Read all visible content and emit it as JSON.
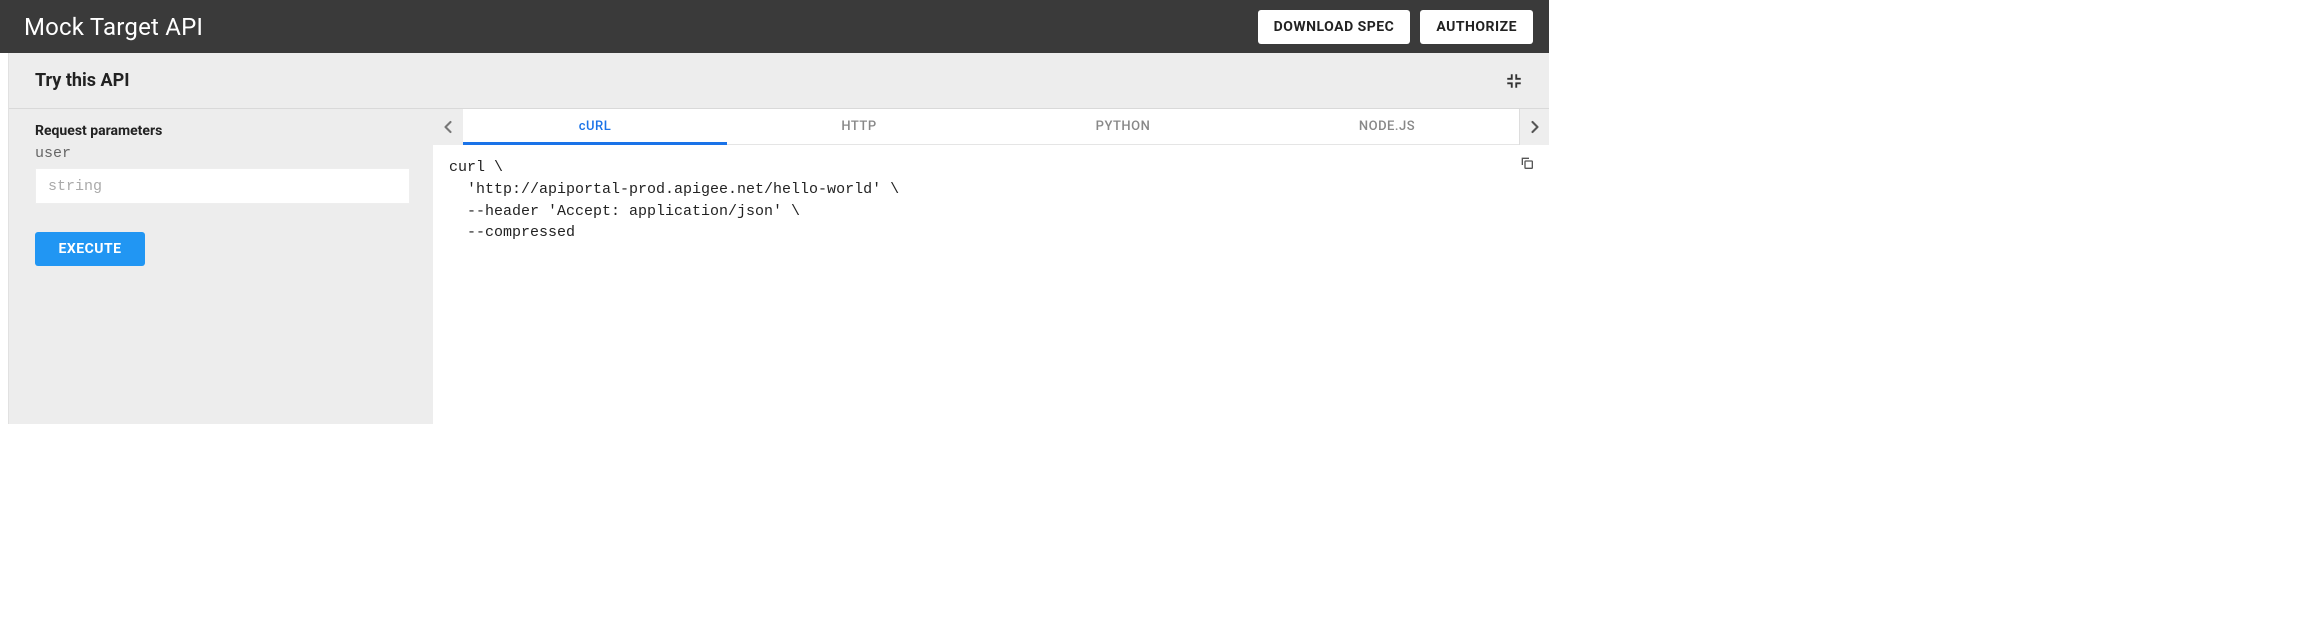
{
  "topbar": {
    "title": "Mock Target API",
    "download_label": "DOWNLOAD SPEC",
    "authorize_label": "AUTHORIZE"
  },
  "panel": {
    "title": "Try this API"
  },
  "request": {
    "section_label": "Request parameters",
    "param_name": "user",
    "param_placeholder": "string",
    "execute_label": "EXECUTE"
  },
  "tabs": {
    "items": [
      "cURL",
      "HTTP",
      "PYTHON",
      "NODE.JS"
    ],
    "active_index": 0
  },
  "code": {
    "curl": "curl \\\n  'http://apiportal-prod.apigee.net/hello-world' \\\n  --header 'Accept: application/json' \\\n  --compressed"
  }
}
